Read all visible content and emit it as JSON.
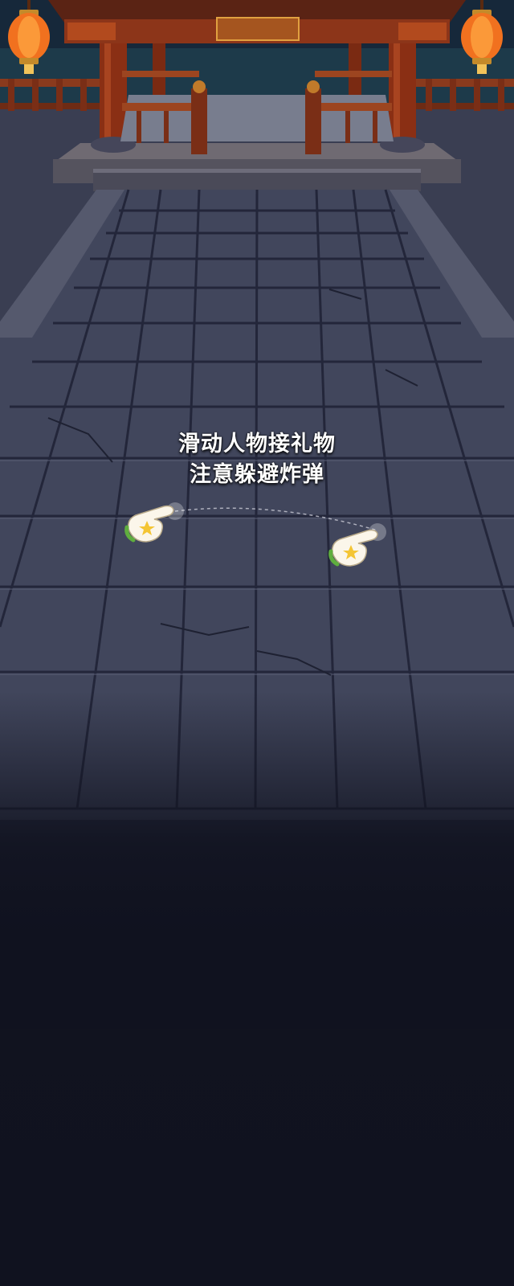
{
  "game": {
    "hint_line1": "滑动人物接礼物",
    "hint_line2": "注意躲避炸弹"
  },
  "icons": {
    "gesture_hand": "pointing-hand-icon",
    "lantern": "red-lantern"
  },
  "colors": {
    "background": "#10121f",
    "stone": "#3d4257",
    "wood": "#7a2e16",
    "lantern": "#f1711f",
    "hint_text": "#ffffff"
  }
}
